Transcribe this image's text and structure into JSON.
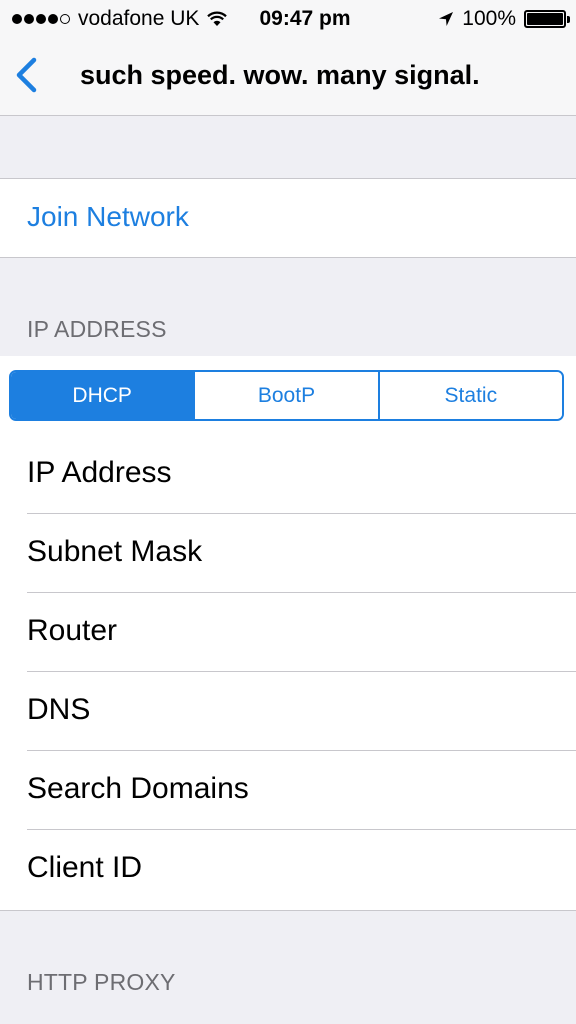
{
  "status_bar": {
    "carrier": "vodafone UK",
    "time": "09:47 pm",
    "battery": "100%",
    "battery_level": 1.0,
    "signal_bars_filled": 4,
    "signal_bars_total": 5
  },
  "nav": {
    "title": "such speed. wow. many signal."
  },
  "join_network": {
    "label": "Join Network"
  },
  "ip_address": {
    "header": "IP ADDRESS",
    "segments": [
      "DHCP",
      "BootP",
      "Static"
    ],
    "selected_segment": "DHCP",
    "rows": [
      "IP Address",
      "Subnet Mask",
      "Router",
      "DNS",
      "Search Domains",
      "Client ID"
    ]
  },
  "http_proxy": {
    "header": "HTTP PROXY"
  },
  "colors": {
    "accent": "#1d7fe0",
    "background": "#efeff4",
    "separator": "#c8c7cc",
    "header_text": "#6d6d72"
  }
}
